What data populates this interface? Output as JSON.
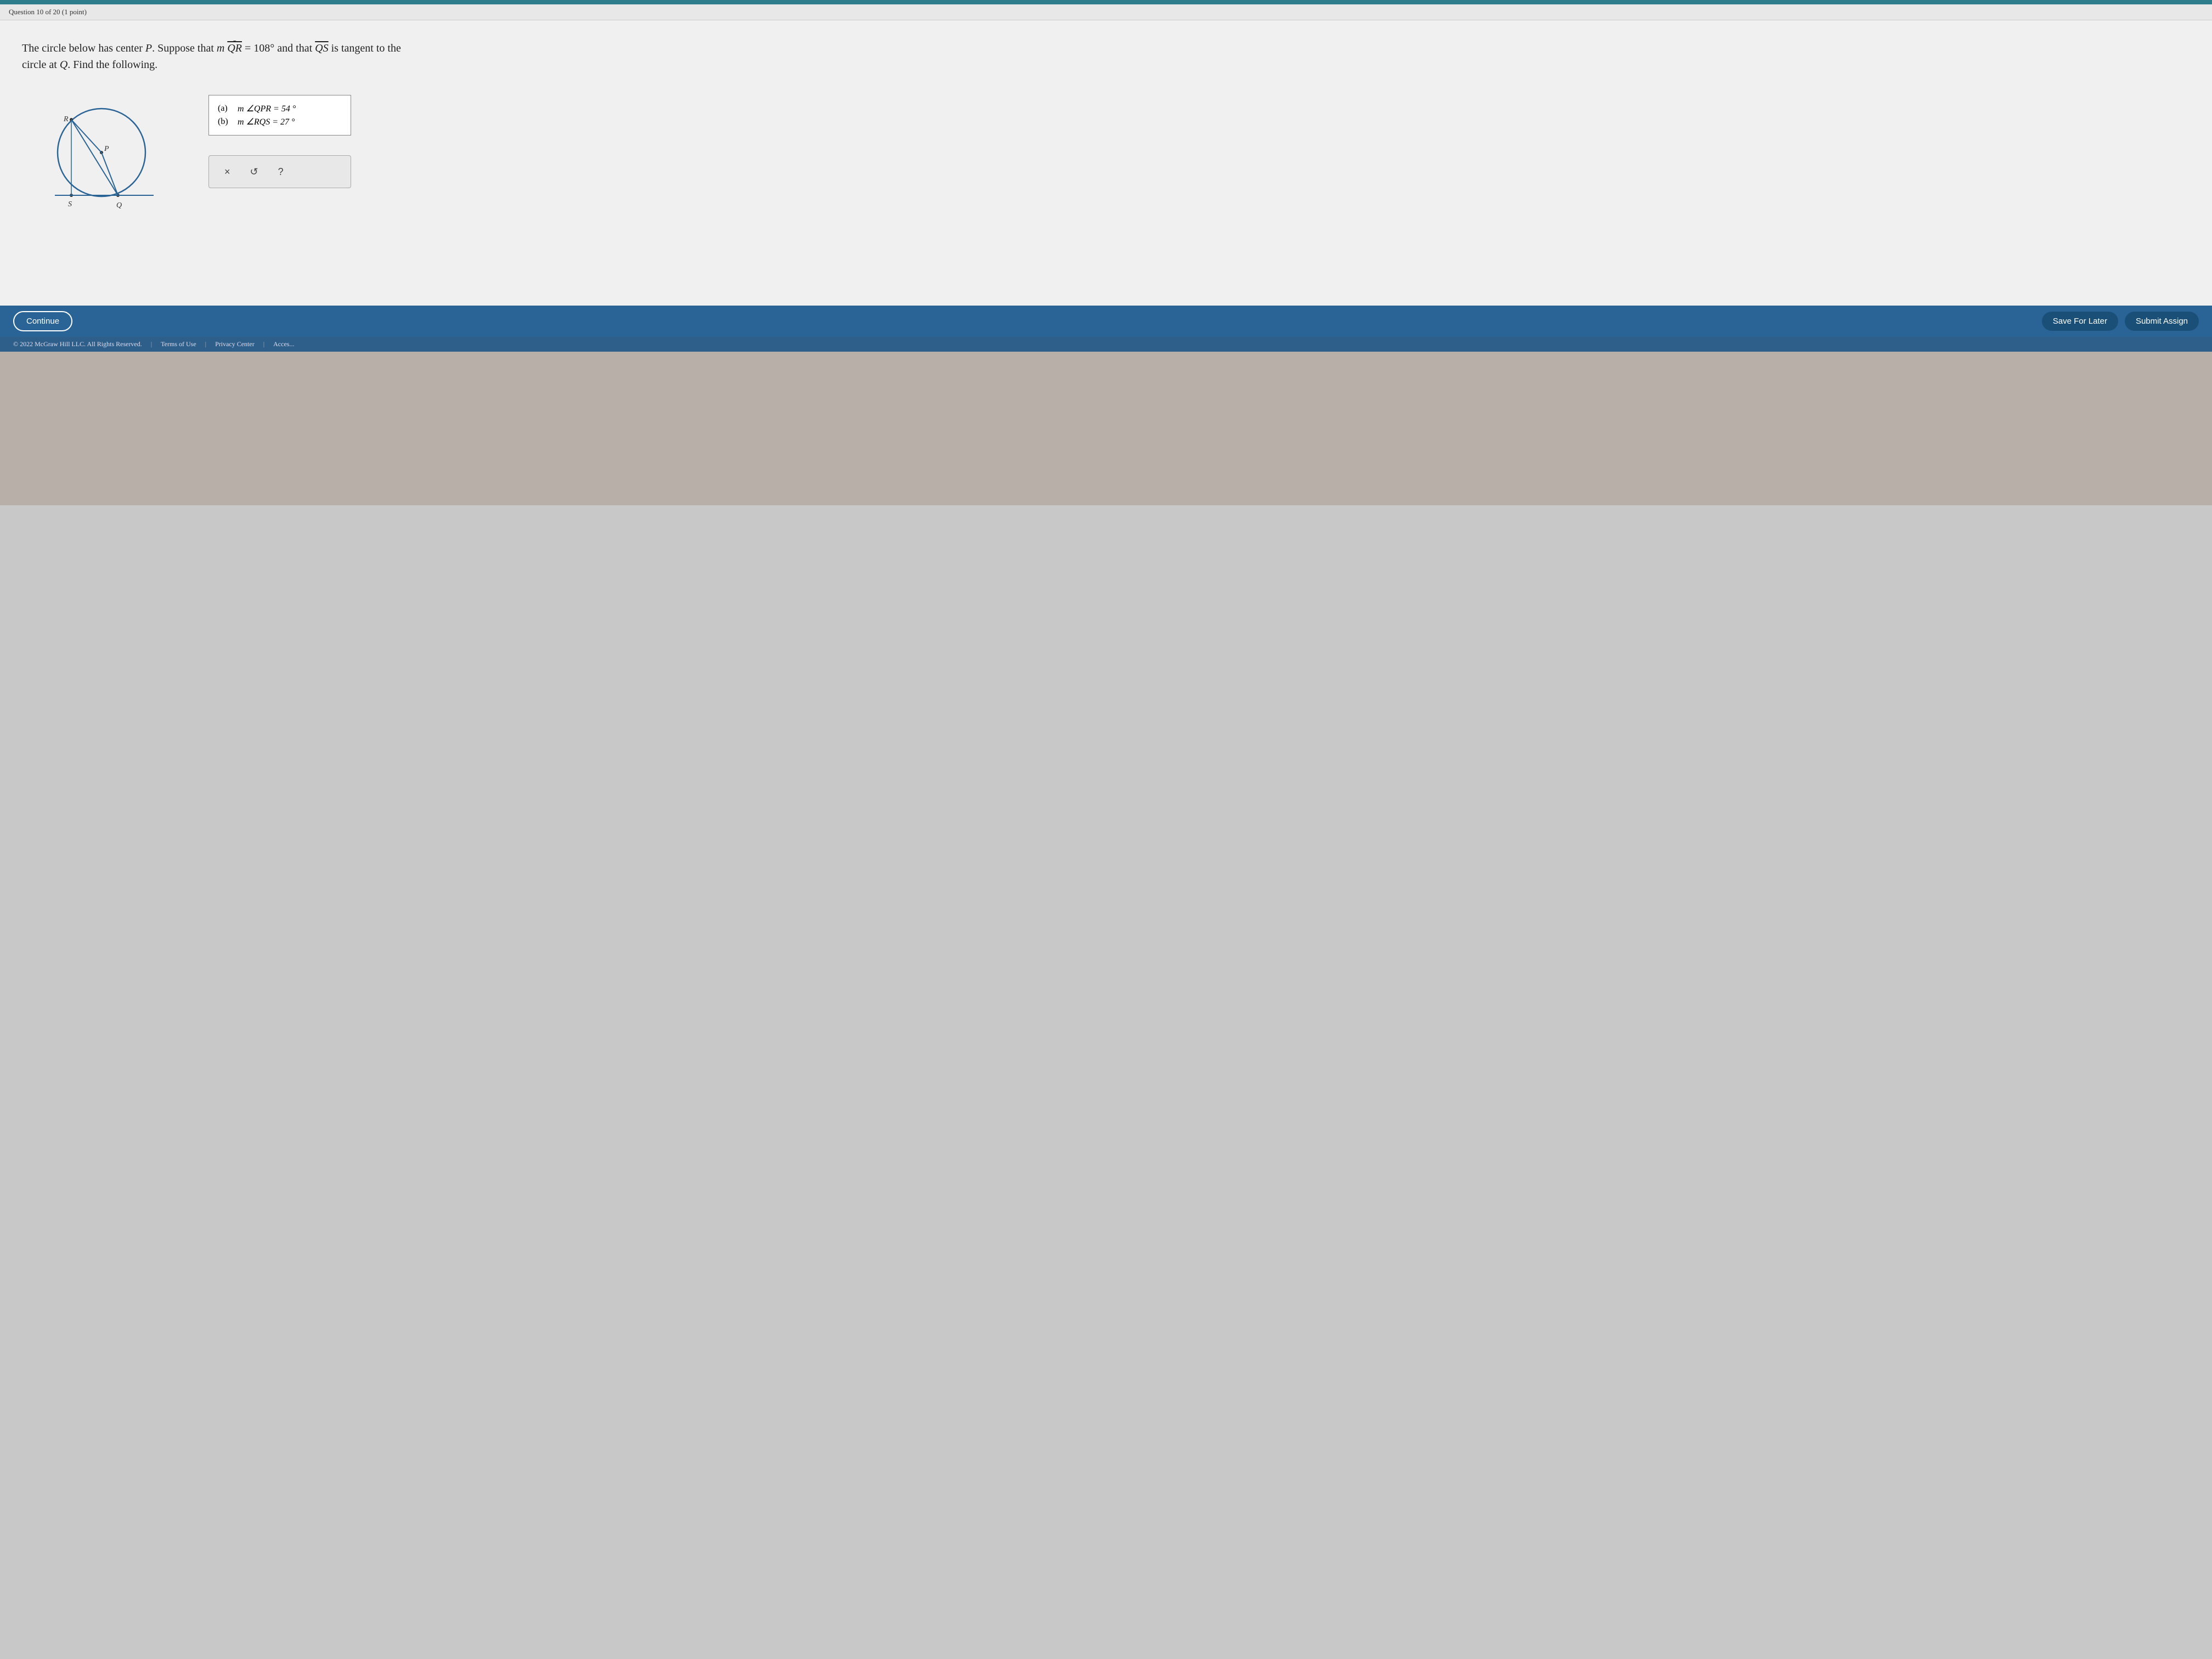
{
  "header": {
    "question_label": "Question 10 of 20 (1 point)"
  },
  "problem": {
    "text_line1": "The circle below has center P. Suppose that m",
    "arc_var": "QR",
    "text_mid": "= 108° and that",
    "overline_var": "QS",
    "text_line2": "is tangent to the circle at Q. Find the following.",
    "part_a_label": "(a)",
    "part_a_formula": "m ∠QPR = 54 °",
    "part_b_label": "(b)",
    "part_b_formula": "m ∠RQS = 27 °"
  },
  "action_buttons": {
    "x_label": "×",
    "undo_label": "↺",
    "help_label": "?"
  },
  "footer": {
    "continue_label": "Continue",
    "save_label": "Save For Later",
    "submit_label": "Submit Assign",
    "copyright": "© 2022 McGraw Hill LLC. All Rights Reserved.",
    "terms_label": "Terms of Use",
    "privacy_label": "Privacy Center",
    "access_label": "Acces..."
  }
}
